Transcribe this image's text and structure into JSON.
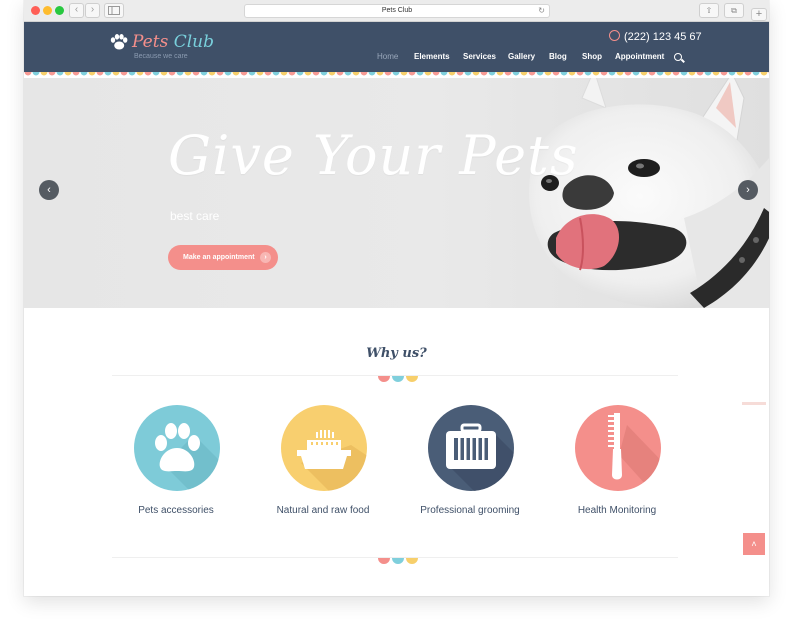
{
  "browser": {
    "url_title": "Pets Club",
    "back_glyph": "‹",
    "forward_glyph": "›",
    "reload_glyph": "↻",
    "share_glyph": "⇧",
    "tabs_glyph": "⧉",
    "new_tab_glyph": "+"
  },
  "header": {
    "logo_name_1": "Pets",
    "logo_name_2": "Club",
    "tagline": "Because we care",
    "phone": "(222) 123 45 67",
    "menu": [
      {
        "label": "Home"
      },
      {
        "label": "Elements"
      },
      {
        "label": "Services"
      },
      {
        "label": "Gallery"
      },
      {
        "label": "Blog"
      },
      {
        "label": "Shop"
      },
      {
        "label": "Appointment"
      }
    ]
  },
  "hero": {
    "title": "Give Your Pets",
    "subtitle": "best care",
    "button_label": "Make an appointment",
    "button_arrow": "›",
    "prev_glyph": "‹",
    "next_glyph": "›"
  },
  "why": {
    "title": "Why us?",
    "features": [
      {
        "label": "Pets accessories",
        "icon": "paw-icon",
        "color": "#7ecbd8"
      },
      {
        "label": "Natural and raw food",
        "icon": "food-bowl-icon",
        "color": "#f8cf6f"
      },
      {
        "label": "Professional grooming",
        "icon": "pet-carrier-icon",
        "color": "#4a5d77"
      },
      {
        "label": "Health Monitoring",
        "icon": "comb-icon",
        "color": "#f48f8b"
      }
    ]
  },
  "back_to_top_glyph": "˄",
  "colors": {
    "header_bg": "#3f5068",
    "accent_pink": "#f48f8b",
    "accent_teal": "#7fcfdc",
    "accent_yellow": "#f7cf6b"
  }
}
